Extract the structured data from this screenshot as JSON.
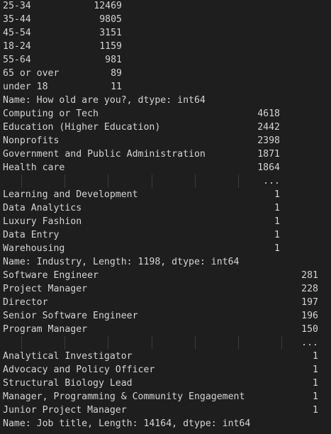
{
  "output_blocks": [
    {
      "rows": [
        {
          "label": "25-34",
          "value": "12469"
        },
        {
          "label": "35-44",
          "value": "9805"
        },
        {
          "label": "45-54",
          "value": "3151"
        },
        {
          "label": "18-24",
          "value": "1159"
        },
        {
          "label": "55-64",
          "value": "981"
        },
        {
          "label": "65 or over",
          "value": "89"
        },
        {
          "label": "under 18",
          "value": "11"
        }
      ],
      "footer": "Name: How old are you?, dtype: int64"
    },
    {
      "rows": [
        {
          "label": "Computing or Tech",
          "value": "4618"
        },
        {
          "label": "Education (Higher Education)",
          "value": "2442"
        },
        {
          "label": "Nonprofits",
          "value": "2398"
        },
        {
          "label": "Government and Public Administration",
          "value": "1871"
        },
        {
          "label": "Health care",
          "value": "1864"
        },
        {
          "label": "",
          "value": "..."
        },
        {
          "label": "Learning and Development",
          "value": "1"
        },
        {
          "label": "Data Analytics",
          "value": "1"
        },
        {
          "label": "Luxury Fashion",
          "value": "1"
        },
        {
          "label": "Data Entry",
          "value": "1"
        },
        {
          "label": "Warehousing",
          "value": "1"
        }
      ],
      "footer": "Name: Industry, Length: 1198, dtype: int64"
    },
    {
      "rows": [
        {
          "label": "Software Engineer",
          "value": "281"
        },
        {
          "label": "Project Manager",
          "value": "228"
        },
        {
          "label": "Director",
          "value": "197"
        },
        {
          "label": "Senior Software Engineer",
          "value": "196"
        },
        {
          "label": "Program Manager",
          "value": "150"
        },
        {
          "label": "",
          "value": "..."
        },
        {
          "label": "Analytical Investigator",
          "value": "1"
        },
        {
          "label": "Advocacy and Policy Officer",
          "value": "1"
        },
        {
          "label": "Structural Biology Lead",
          "value": "1"
        },
        {
          "label": "Manager, Programming & Community Engagement",
          "value": "1"
        },
        {
          "label": "Junior Project Manager",
          "value": "1"
        }
      ],
      "footer": "Name: Job title, Length: 14164, dtype: int64"
    }
  ]
}
